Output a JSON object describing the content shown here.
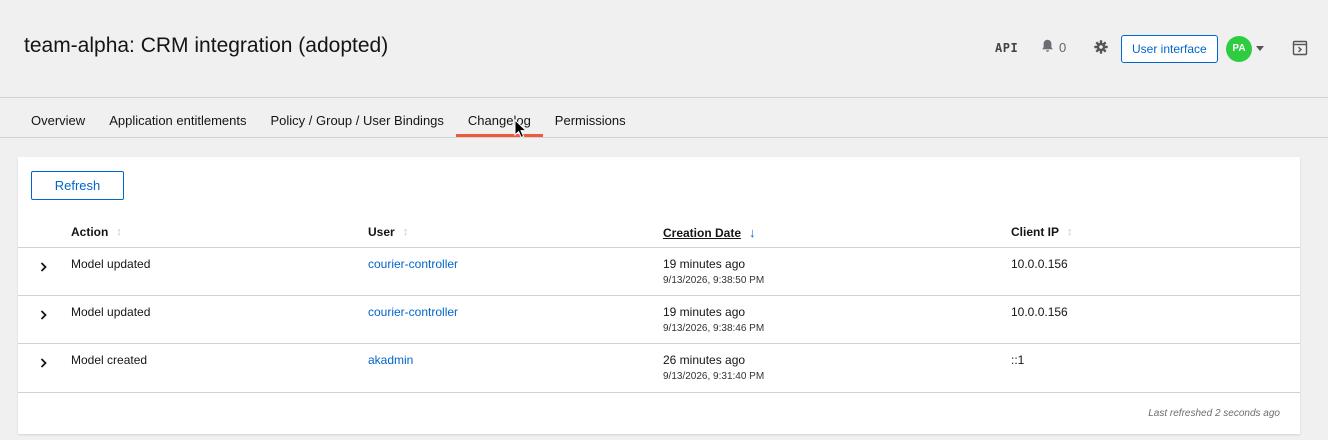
{
  "header": {
    "title": "team-alpha: CRM integration (adopted)",
    "api_label": "API",
    "notification_count": "0",
    "user_interface_label": "User interface",
    "avatar_initials": "PA"
  },
  "tabs": [
    {
      "label": "Overview",
      "active": false
    },
    {
      "label": "Application entitlements",
      "active": false
    },
    {
      "label": "Policy / Group / User Bindings",
      "active": false
    },
    {
      "label": "Changelog",
      "active": true
    },
    {
      "label": "Permissions",
      "active": false
    }
  ],
  "toolbar": {
    "refresh_label": "Refresh"
  },
  "table": {
    "columns": {
      "action": "Action",
      "user": "User",
      "creation_date": "Creation Date",
      "client_ip": "Client IP"
    },
    "sorted_by": "creation_date",
    "sort_direction": "descending",
    "rows": [
      {
        "action": "Model updated",
        "user": "courier-controller",
        "relative": "19 minutes ago",
        "timestamp": "9/13/2026, 9:38:50 PM",
        "client_ip": "10.0.0.156"
      },
      {
        "action": "Model updated",
        "user": "courier-controller",
        "relative": "19 minutes ago",
        "timestamp": "9/13/2026, 9:38:46 PM",
        "client_ip": "10.0.0.156"
      },
      {
        "action": "Model created",
        "user": "akadmin",
        "relative": "26 minutes ago",
        "timestamp": "9/13/2026, 9:31:40 PM",
        "client_ip": "::1"
      }
    ]
  },
  "footer": {
    "last_refreshed": "Last refreshed 2 seconds ago"
  },
  "icons": {
    "notifications": "bell-icon",
    "settings": "gear-icon",
    "drawer": "drawer-toggle-icon",
    "expand": "chevron-right-icon",
    "sort": "sort-icon",
    "sort_active": "arrow-down-icon"
  },
  "colors": {
    "accent": "#0066cc",
    "active_tab": "#ee5a3e",
    "avatar": "#2ecc40",
    "background": "#f0f0f0"
  }
}
